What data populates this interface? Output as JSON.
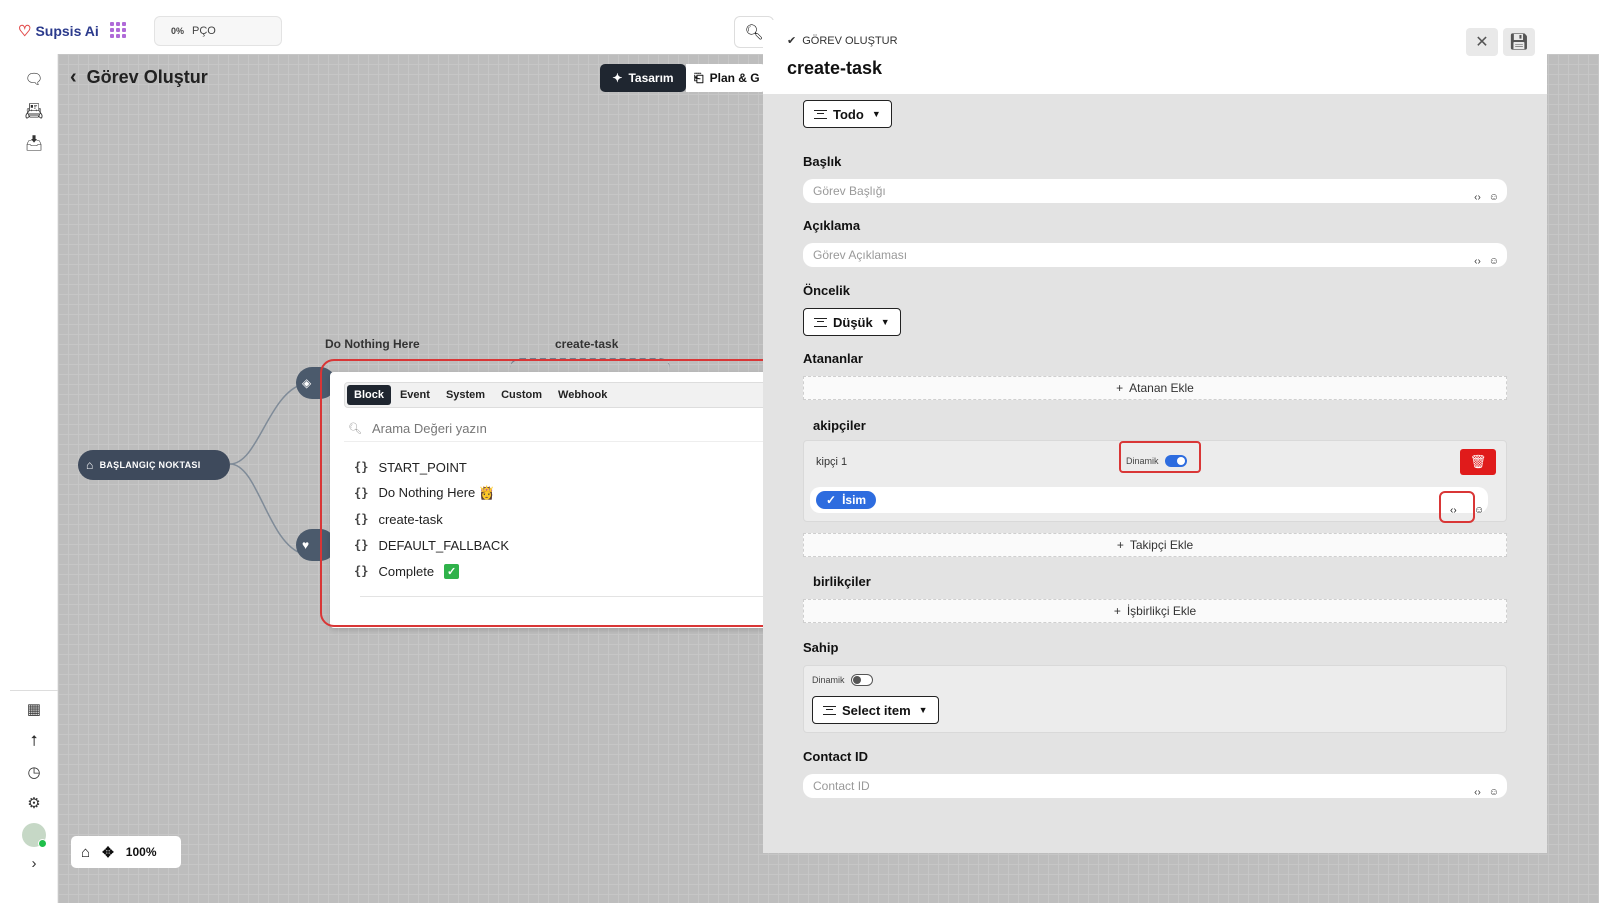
{
  "app": {
    "name": "Supsis Ai",
    "org_pct": "0%",
    "org_code": "PÇO"
  },
  "canvas": {
    "title": "Görev Oluştur",
    "tab_design": "Tasarım",
    "tab_plan": "Plan & G",
    "node_do_nothing": "Do Nothing Here",
    "node_create_task": "create-task",
    "start_node": "BAŞLANGIÇ NOKTASI",
    "zoom": "100%"
  },
  "popup": {
    "tabs": [
      "Block",
      "Event",
      "System",
      "Custom",
      "Webhook"
    ],
    "active_tab": "Block",
    "search_placeholder": "Arama Değeri yazın",
    "items": [
      "START_POINT",
      "Do Nothing Here 👸",
      "create-task",
      "DEFAULT_FALLBACK",
      "Complete"
    ]
  },
  "panel": {
    "kicker": "GÖREV OLUŞTUR",
    "title": "create-task",
    "status": "Todo",
    "title_label": "Başlık",
    "title_placeholder": "Görev Başlığı",
    "desc_label": "Açıklama",
    "desc_placeholder": "Görev Açıklaması",
    "priority_label": "Öncelik",
    "priority_value": "Düşük",
    "assignees_label": "Atananlar",
    "assignee_add": "Atanan Ekle",
    "followers_label": "akipçiler",
    "follower_1": "kipçi 1",
    "dynamic_label": "Dinamik",
    "follower_tag": "İsim",
    "follower_add": "Takipçi Ekle",
    "collab_label": "birlikçiler",
    "collab_add": "İşbirlikçi Ekle",
    "owner_label": "Sahip",
    "owner_dynamic": "Dinamik",
    "owner_select": "Select item",
    "contact_label": "Contact ID",
    "contact_placeholder": "Contact ID"
  },
  "colors": {
    "accent": "#2d6cdf",
    "danger": "#e01b1b",
    "annotation": "#d93636",
    "dark": "#1f2630"
  }
}
